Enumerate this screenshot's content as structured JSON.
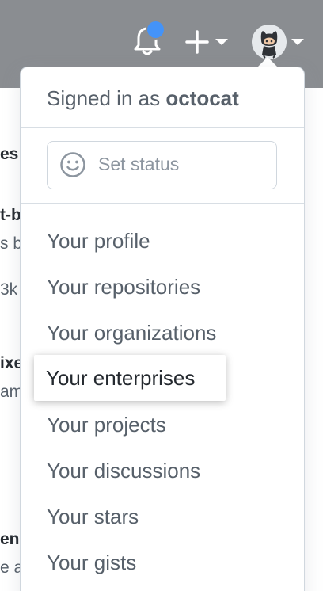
{
  "header": {
    "notification_dot_color": "#4493f8",
    "bell_icon": "bell-icon",
    "plus_icon": "plus-icon",
    "caret_icon": "chevron-down-icon",
    "avatar_icon": "octocat-avatar"
  },
  "background": {
    "fragments": [
      {
        "text": "es"
      },
      {
        "text": "t-b"
      },
      {
        "text": "s b"
      },
      {
        "text": "3k"
      },
      {
        "text": "ixe"
      },
      {
        "text": "am"
      },
      {
        "text": "en"
      },
      {
        "text": "e a"
      }
    ]
  },
  "dropdown": {
    "signed_in_prefix": "Signed in as ",
    "username": "octocat",
    "status_placeholder": "Set status",
    "status_icon": "smiley-icon",
    "items": [
      {
        "label": "Your profile"
      },
      {
        "label": "Your repositories"
      },
      {
        "label": "Your organizations"
      },
      {
        "label": "Your enterprises"
      },
      {
        "label": "Your projects"
      },
      {
        "label": "Your discussions"
      },
      {
        "label": "Your stars"
      },
      {
        "label": "Your gists"
      }
    ],
    "highlighted_item": "Your enterprises"
  }
}
